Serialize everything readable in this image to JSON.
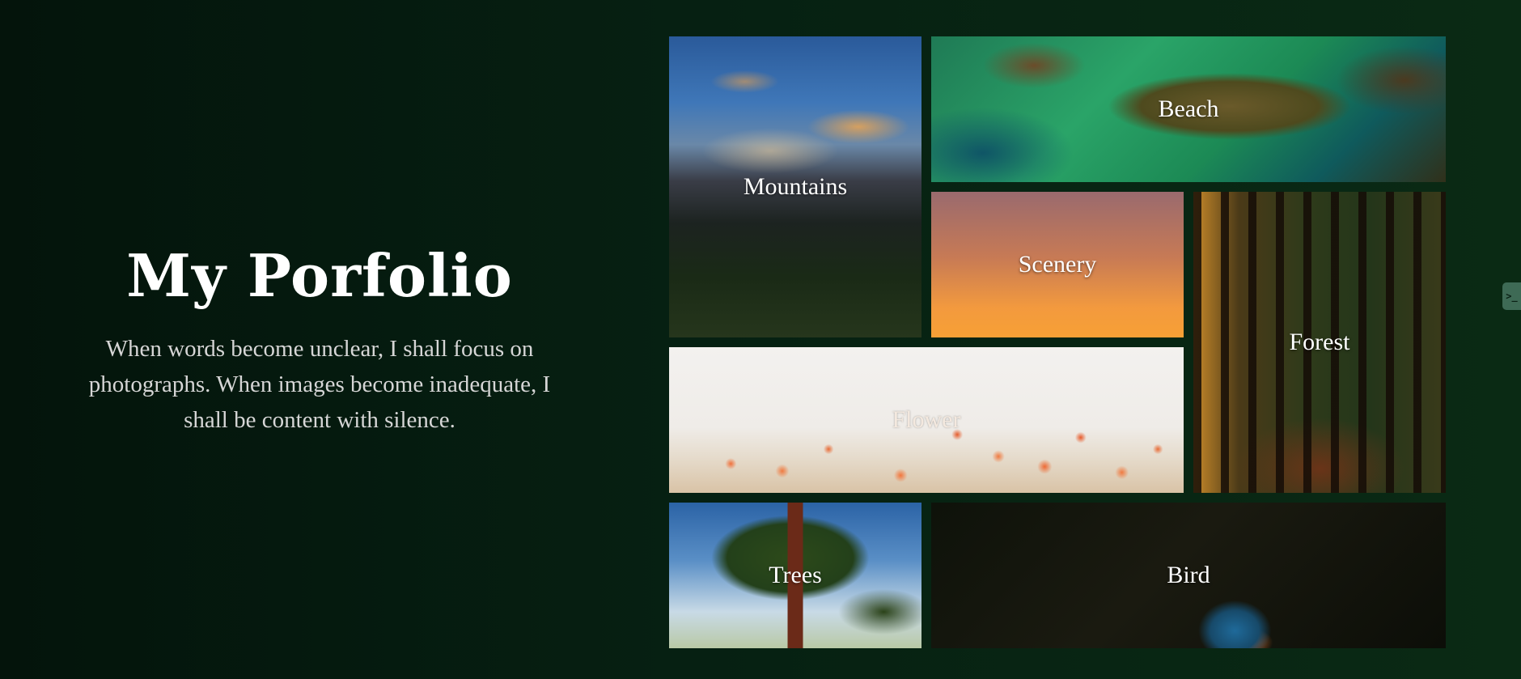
{
  "intro": {
    "title": "My Porfolio",
    "description": "When words become unclear, I shall focus on photographs. When images become inadequate, I shall be content with silence."
  },
  "gallery": {
    "tiles": [
      {
        "label": "Mountains"
      },
      {
        "label": "Beach"
      },
      {
        "label": "Scenery"
      },
      {
        "label": "Forest"
      },
      {
        "label": "Flower"
      },
      {
        "label": "Trees"
      },
      {
        "label": "Bird"
      }
    ]
  },
  "side_handle": {
    "icon": "terminal-chevron-icon",
    "glyph": ">_"
  }
}
